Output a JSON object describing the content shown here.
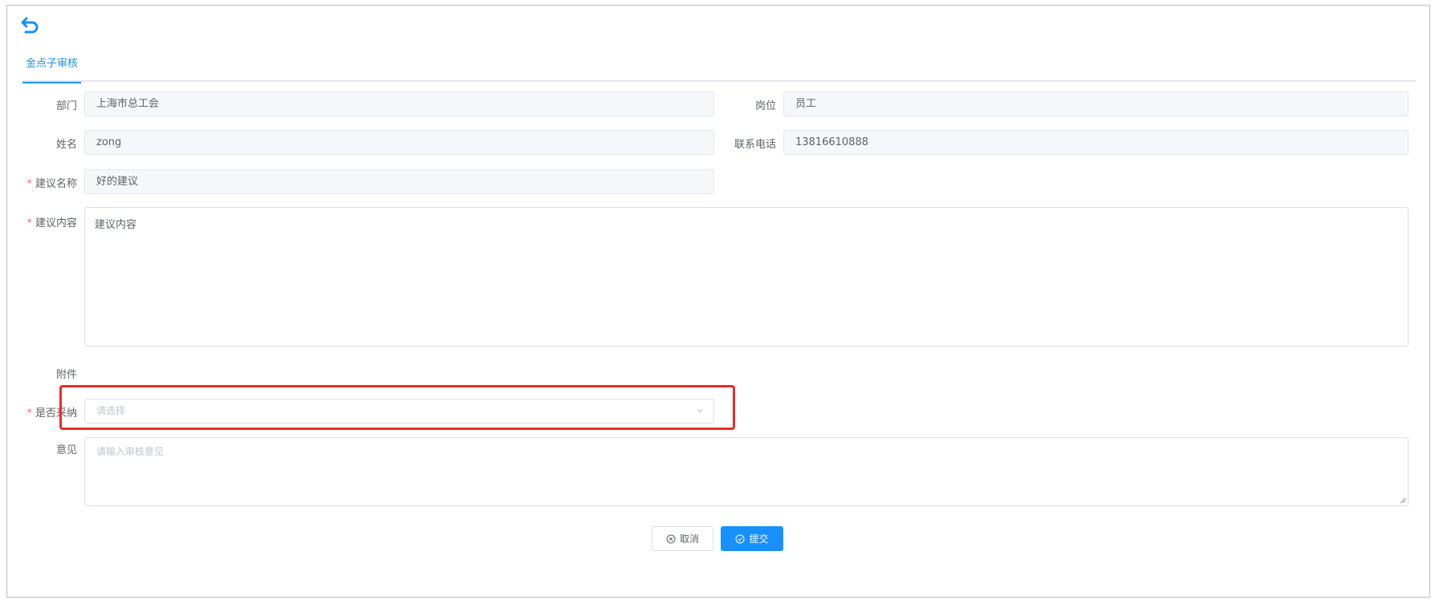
{
  "colors": {
    "accent": "#1890ff",
    "required": "#f56c6c",
    "highlight": "#ee2a2a"
  },
  "header": {
    "back_icon": "back-arrow-icon"
  },
  "tabs": [
    {
      "label": "金点子审核",
      "active": true
    }
  ],
  "form": {
    "department": {
      "label": "部门",
      "value": "上海市总工会"
    },
    "position": {
      "label": "岗位",
      "value": "员工"
    },
    "name": {
      "label": "姓名",
      "value": "zong"
    },
    "phone": {
      "label": "联系电话",
      "value": "13816610888"
    },
    "suggestion_name": {
      "label": "建议名称",
      "value": "好的建议",
      "required": true
    },
    "suggestion_content": {
      "label": "建议内容",
      "value": "建议内容",
      "required": true
    },
    "attachment": {
      "label": "附件"
    },
    "adopted": {
      "label": "是否采纳",
      "placeholder": "请选择",
      "required": true
    },
    "opinion": {
      "label": "意见",
      "placeholder": "请输入审核意见",
      "value": ""
    }
  },
  "actions": {
    "cancel_label": "取消",
    "submit_label": "提交"
  }
}
